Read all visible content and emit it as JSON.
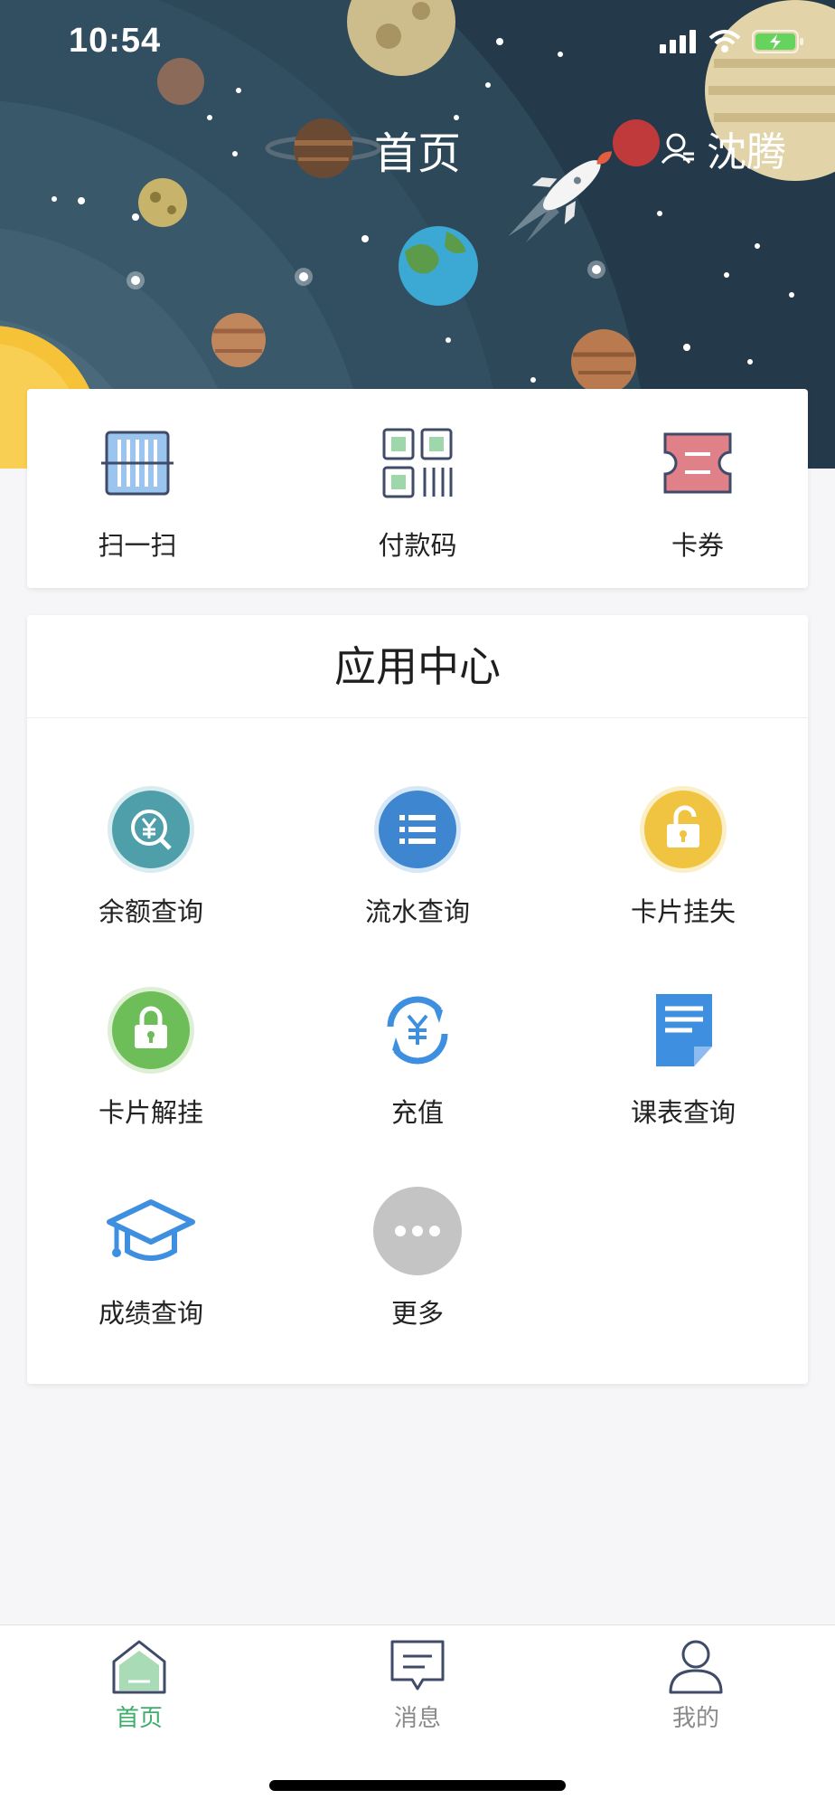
{
  "status_bar": {
    "time": "10:54"
  },
  "header": {
    "title": "首页",
    "user_name": "沈腾"
  },
  "quick_actions": [
    {
      "label": "扫一扫",
      "icon": "scan-icon"
    },
    {
      "label": "付款码",
      "icon": "payment-code-icon"
    },
    {
      "label": "卡券",
      "icon": "ticket-icon"
    }
  ],
  "app_center": {
    "title": "应用中心",
    "apps": [
      {
        "label": "余额查询",
        "icon": "balance-query-icon"
      },
      {
        "label": "流水查询",
        "icon": "transaction-list-icon"
      },
      {
        "label": "卡片挂失",
        "icon": "card-lock-icon"
      },
      {
        "label": "卡片解挂",
        "icon": "card-unlock-icon"
      },
      {
        "label": "充值",
        "icon": "recharge-icon"
      },
      {
        "label": "课表查询",
        "icon": "timetable-icon"
      },
      {
        "label": "成绩查询",
        "icon": "grades-icon"
      },
      {
        "label": "更多",
        "icon": "more-icon"
      }
    ]
  },
  "tab_bar": [
    {
      "label": "首页",
      "icon": "home-icon",
      "active": true
    },
    {
      "label": "消息",
      "icon": "message-icon",
      "active": false
    },
    {
      "label": "我的",
      "icon": "profile-icon",
      "active": false
    }
  ],
  "colors": {
    "accent": "#3fae6a",
    "tab_inactive": "#8a8a8a",
    "space_bg": "#2b4556",
    "sun": "#f6c338"
  }
}
